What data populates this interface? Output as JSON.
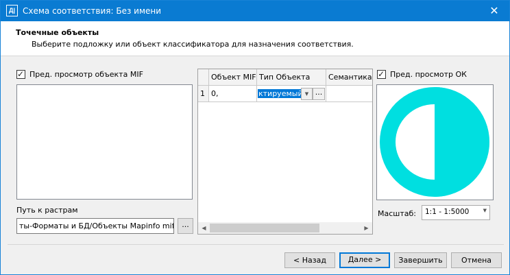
{
  "window": {
    "title": "Схема соответствия: Без имени",
    "icon_label": "Д|",
    "close_glyph": "✕"
  },
  "header": {
    "title": "Точечные объекты",
    "subtitle": "Выберите подложку или объект классификатора для назначения соответствия."
  },
  "left": {
    "preview_label": "Пред. просмотр объекта MIF",
    "preview_checked": true,
    "path_label": "Путь к растрам",
    "path_value": "ты-Форматы и БД/Объекты Mapinfo mif mid",
    "browse_label": "..."
  },
  "grid": {
    "columns": [
      "Объект MIF",
      "Тип Объекта",
      "Семантика"
    ],
    "rows": [
      {
        "num": "1",
        "mif": "0,",
        "type": "ктируемый",
        "button": "..."
      }
    ]
  },
  "right": {
    "preview_label": "Пред. просмотр ОК",
    "preview_checked": true,
    "scale_label": "Масштаб:",
    "scale_value": "1:1 - 1:5000",
    "symbol_color": "#00dfe0"
  },
  "footer": {
    "back_label": "< Назад",
    "next_label": "Далее >",
    "finish_label": "Завершить",
    "cancel_label": "Отмена"
  },
  "icons": {
    "check": "✓",
    "dropdown": "▼",
    "scroll_left": "◀",
    "scroll_right": "▶"
  }
}
